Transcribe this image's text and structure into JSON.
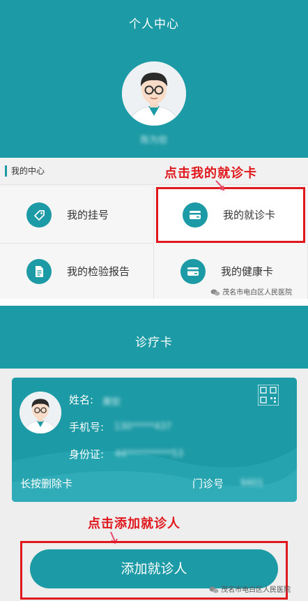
{
  "profile": {
    "title": "个人中心",
    "user_name": "陈为钦",
    "section_label": "我的中心",
    "menu": [
      {
        "label": "我的挂号",
        "icon": "register-tag-icon"
      },
      {
        "label": "我的就诊卡",
        "icon": "card-icon"
      },
      {
        "label": "我的检验报告",
        "icon": "report-document-icon"
      },
      {
        "label": "我的健康卡",
        "icon": "card-icon"
      }
    ],
    "annotation": "点击我的就诊卡"
  },
  "card_page": {
    "title": "诊疗卡",
    "fields": {
      "name_label": "姓名:",
      "name_value": "黄钦",
      "phone_label": "手机号:",
      "phone_value": "130*****437",
      "id_label": "身份证:",
      "id_value": "44**********53",
      "long_press_label": "长按删除卡",
      "clinic_no_label": "门诊号",
      "clinic_no_value": "9401"
    },
    "annotation": "点击添加就诊人",
    "add_button": "添加就诊人"
  },
  "watermark": "茂名市电白区人民医院",
  "colors": {
    "primary": "#1c9aa5",
    "annotation": "#e0171c"
  }
}
